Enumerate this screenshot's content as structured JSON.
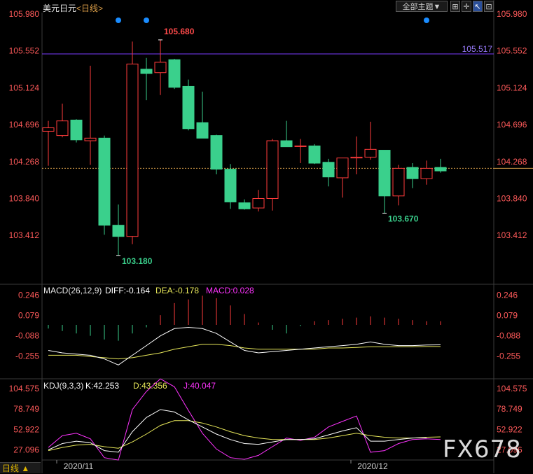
{
  "header": {
    "symbol": "美元日元",
    "period": "日线"
  },
  "toolbar": {
    "theme_label": "全部主题▼",
    "expand_icon": "expand-icon",
    "crosshair_icon": "crosshair-icon",
    "cursor_icon": "cursor-icon",
    "lock_icon": "lock-icon"
  },
  "status_bar": {
    "period_label": "日线 ▲"
  },
  "watermark": "FX678",
  "colors": {
    "up": "#ff3b3b",
    "down": "#3ad08c",
    "hline": "#7a3cff",
    "diff": "#ffffff",
    "dea": "#e8e85a",
    "macd_text": "#ff33ff",
    "k": "#ffffff",
    "d": "#e8e85a",
    "j": "#ff33ff"
  },
  "chart_data": {
    "type": "candlestick",
    "x_labels": [
      {
        "i": 1,
        "text": "2020/11"
      },
      {
        "i": 22,
        "text": "2020/12"
      }
    ],
    "price_axis": {
      "ticks": [
        "105.980",
        "105.552",
        "105.124",
        "104.696",
        "104.268",
        "103.840",
        "103.412"
      ],
      "range": [
        103.3,
        105.98
      ]
    },
    "hline": {
      "value": 105.517,
      "label": "105.517"
    },
    "last_price": 104.19,
    "annotations": [
      {
        "i": 8,
        "value": 105.68,
        "label": "105.680",
        "pos": "top"
      },
      {
        "i": 5,
        "value": 103.18,
        "label": "103.180",
        "pos": "bottom"
      },
      {
        "i": 24,
        "value": 103.67,
        "label": "103.670",
        "pos": "bottom"
      }
    ],
    "markers_i": [
      5,
      7,
      27
    ],
    "candles": [
      {
        "o": 104.62,
        "h": 104.74,
        "l": 104.22,
        "c": 104.66
      },
      {
        "o": 104.57,
        "h": 104.94,
        "l": 104.55,
        "c": 104.74
      },
      {
        "o": 104.75,
        "h": 104.76,
        "l": 104.49,
        "c": 104.52
      },
      {
        "o": 104.51,
        "h": 105.38,
        "l": 104.23,
        "c": 104.54
      },
      {
        "o": 104.54,
        "h": 104.57,
        "l": 103.42,
        "c": 103.53
      },
      {
        "o": 103.53,
        "h": 103.77,
        "l": 103.18,
        "c": 103.4
      },
      {
        "o": 103.4,
        "h": 105.66,
        "l": 103.31,
        "c": 105.4
      },
      {
        "o": 105.34,
        "h": 105.47,
        "l": 104.98,
        "c": 105.29
      },
      {
        "o": 105.3,
        "h": 105.68,
        "l": 105.04,
        "c": 105.42
      },
      {
        "o": 105.45,
        "h": 105.46,
        "l": 105.11,
        "c": 105.13
      },
      {
        "o": 105.14,
        "h": 105.22,
        "l": 104.63,
        "c": 104.65
      },
      {
        "o": 104.72,
        "h": 105.08,
        "l": 104.54,
        "c": 104.54
      },
      {
        "o": 104.57,
        "h": 104.58,
        "l": 104.12,
        "c": 104.18
      },
      {
        "o": 104.18,
        "h": 104.24,
        "l": 103.72,
        "c": 103.8
      },
      {
        "o": 103.79,
        "h": 103.83,
        "l": 103.71,
        "c": 103.72
      },
      {
        "o": 103.73,
        "h": 103.94,
        "l": 103.69,
        "c": 103.84
      },
      {
        "o": 103.84,
        "h": 104.53,
        "l": 103.7,
        "c": 104.51
      },
      {
        "o": 104.51,
        "h": 104.74,
        "l": 104.44,
        "c": 104.44
      },
      {
        "o": 104.45,
        "h": 104.53,
        "l": 104.25,
        "c": 104.45
      },
      {
        "o": 104.45,
        "h": 104.47,
        "l": 104.24,
        "c": 104.25
      },
      {
        "o": 104.26,
        "h": 104.3,
        "l": 103.98,
        "c": 104.09
      },
      {
        "o": 104.08,
        "h": 104.3,
        "l": 103.85,
        "c": 104.31
      },
      {
        "o": 104.31,
        "h": 104.56,
        "l": 104.12,
        "c": 104.32
      },
      {
        "o": 104.32,
        "h": 104.73,
        "l": 104.29,
        "c": 104.41
      },
      {
        "o": 104.4,
        "h": 104.4,
        "l": 103.67,
        "c": 103.87
      },
      {
        "o": 103.87,
        "h": 104.23,
        "l": 103.76,
        "c": 104.19
      },
      {
        "o": 104.2,
        "h": 104.25,
        "l": 103.96,
        "c": 104.07
      },
      {
        "o": 104.07,
        "h": 104.28,
        "l": 104.0,
        "c": 104.19
      },
      {
        "o": 104.2,
        "h": 104.3,
        "l": 104.14,
        "c": 104.16
      }
    ],
    "macd": {
      "title": "MACD(26,12,9)",
      "diff_label": "DIFF:-0.164",
      "dea_label": "DEA:-0.178",
      "macd_label": "MACD:0.028",
      "ticks": [
        "0.246",
        "0.079",
        "-0.088",
        "-0.255"
      ],
      "range": [
        -0.38,
        0.3
      ],
      "hist": [
        -0.03,
        -0.05,
        -0.07,
        -0.09,
        -0.12,
        -0.13,
        -0.07,
        -0.02,
        0.08,
        0.18,
        0.21,
        0.24,
        0.22,
        0.16,
        0.09,
        0.02,
        -0.04,
        -0.07,
        -0.01,
        0.03,
        0.04,
        0.05,
        0.06,
        0.07,
        0.06,
        0.05,
        0.04,
        0.03,
        0.03
      ],
      "diff": [
        -0.21,
        -0.23,
        -0.24,
        -0.25,
        -0.28,
        -0.33,
        -0.25,
        -0.17,
        -0.09,
        -0.03,
        -0.02,
        -0.03,
        -0.07,
        -0.14,
        -0.21,
        -0.23,
        -0.22,
        -0.21,
        -0.2,
        -0.19,
        -0.18,
        -0.17,
        -0.16,
        -0.14,
        -0.16,
        -0.17,
        -0.17,
        -0.165,
        -0.164
      ],
      "dea": [
        -0.25,
        -0.25,
        -0.25,
        -0.26,
        -0.27,
        -0.28,
        -0.27,
        -0.25,
        -0.23,
        -0.2,
        -0.18,
        -0.16,
        -0.16,
        -0.17,
        -0.19,
        -0.2,
        -0.2,
        -0.2,
        -0.2,
        -0.2,
        -0.19,
        -0.19,
        -0.185,
        -0.18,
        -0.18,
        -0.18,
        -0.18,
        -0.178,
        -0.178
      ]
    },
    "kdj": {
      "title": "KDJ(9,3,3)",
      "k_label": "K:42.253",
      "d_label": "D:43.356",
      "j_label": "J:40.047",
      "ticks": [
        "104.575",
        "78.749",
        "52.922",
        "27.096"
      ],
      "range": [
        15,
        110
      ],
      "k": [
        27,
        35,
        38,
        36,
        26,
        24,
        50,
        68,
        78,
        75,
        65,
        56,
        47,
        40,
        35,
        34,
        37,
        40,
        40,
        41,
        46,
        51,
        55,
        38,
        38,
        40,
        42,
        42.3
      ],
      "d": [
        26,
        30,
        33,
        34,
        31,
        29,
        37,
        47,
        58,
        64,
        64,
        61,
        56,
        50,
        45,
        42,
        40,
        40,
        40,
        40,
        42,
        45,
        48,
        45,
        43,
        42,
        42,
        43,
        43.4
      ],
      "j": [
        30,
        45,
        48,
        41,
        17,
        14,
        78,
        101,
        117,
        107,
        77,
        48,
        28,
        17,
        15,
        20,
        31,
        42,
        39,
        43,
        56,
        63,
        70,
        24,
        26,
        35,
        40,
        41,
        40
      ]
    }
  }
}
